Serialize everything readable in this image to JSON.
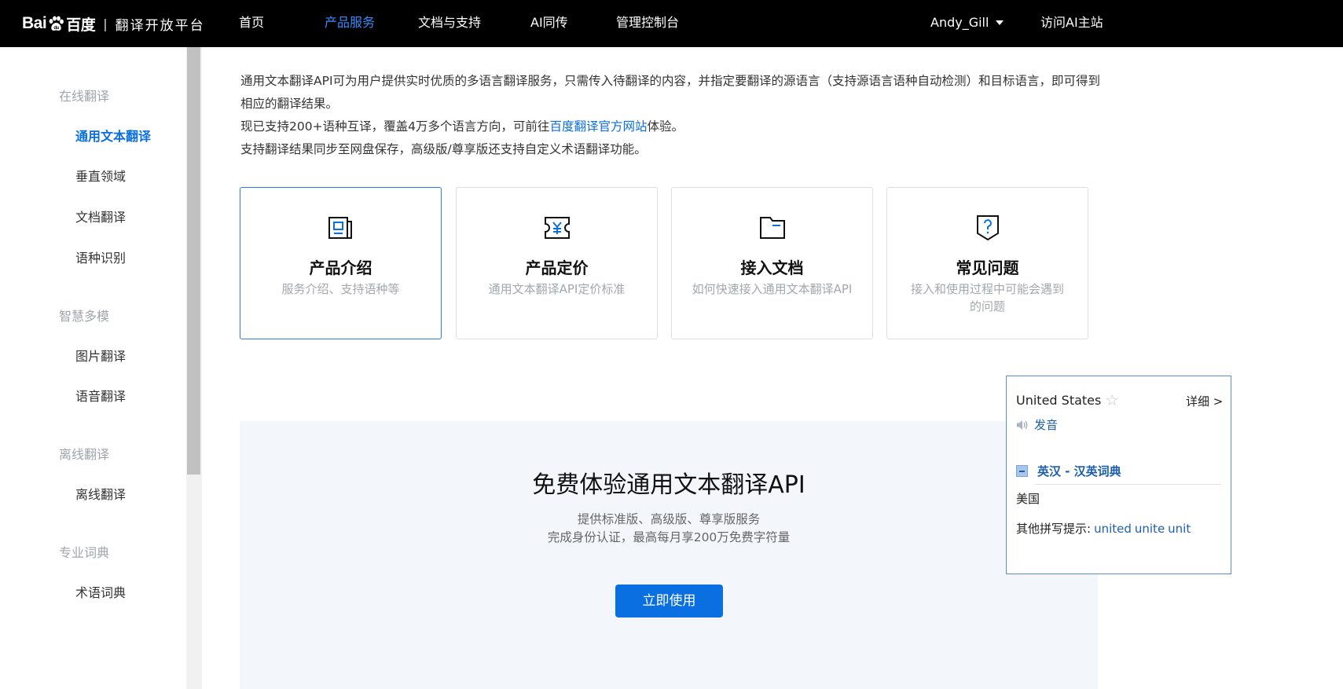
{
  "header": {
    "logo_mark_left": "Bai",
    "logo_mark_right": "百度",
    "logo_separator": "|",
    "logo_title": "翻译开放平台",
    "nav": [
      {
        "label": "首页"
      },
      {
        "label": "产品服务"
      },
      {
        "label": "文档与支持"
      },
      {
        "label": "AI同传"
      },
      {
        "label": "管理控制台"
      }
    ],
    "active_nav": "产品服务",
    "user": "Andy_Gill",
    "visit_link": "访问AI主站"
  },
  "sidebar": {
    "groups": [
      {
        "title": "在线翻译",
        "items": [
          {
            "label": "通用文本翻译",
            "active": true
          },
          {
            "label": "垂直领域"
          },
          {
            "label": "文档翻译"
          },
          {
            "label": "语种识别"
          }
        ]
      },
      {
        "title": "智慧多模",
        "items": [
          {
            "label": "图片翻译"
          },
          {
            "label": "语音翻译"
          }
        ]
      },
      {
        "title": "离线翻译",
        "items": [
          {
            "label": "离线翻译"
          }
        ]
      },
      {
        "title": "专业词典",
        "items": [
          {
            "label": "术语词典"
          }
        ]
      }
    ]
  },
  "intro": {
    "line1": "通用文本翻译API可为用户提供实时优质的多语言翻译服务，只需传入待翻译的内容，并指定要翻译的源语言（支持源语言语种自动检测）和目标语言，即可得到相应的翻译结果。",
    "line2_before": "现已支持200+语种互译，覆盖4万多个语言方向，可前往",
    "line2_link": "百度翻译官方网站",
    "line2_after": "体验。",
    "line3": "支持翻译结果同步至网盘保存，高级版/尊享版还支持自定义术语翻译功能。"
  },
  "cards": [
    {
      "icon": "document-icon",
      "title": "产品介绍",
      "desc": "服务介绍、支持语种等"
    },
    {
      "icon": "pricing-icon",
      "title": "产品定价",
      "desc": "通用文本翻译API定价标准"
    },
    {
      "icon": "folder-icon",
      "title": "接入文档",
      "desc": "如何快速接入通用文本翻译API"
    },
    {
      "icon": "faq-icon",
      "title": "常见问题",
      "desc": "接入和使用过程中可能会遇到的问题"
    }
  ],
  "trial": {
    "title": "免费体验通用文本翻译API",
    "sub1": "提供标准版、高级版、尊享版服务",
    "sub2": "完成身份认证，最高每月享200万免费字符量",
    "button": "立即使用"
  },
  "dict_popup": {
    "word": "United States",
    "detail": "详细 >",
    "speak": "发音",
    "dictionary": "英汉 - 汉英词典",
    "meaning": "美国",
    "hint_label": "其他拼写提示:",
    "suggestions": [
      "united",
      "unite",
      "unit"
    ]
  },
  "colors": {
    "accent": "#0a6fe0",
    "topbar": "#000000",
    "nav_active": "#3a8bff",
    "dict_link": "#1c5fae"
  }
}
